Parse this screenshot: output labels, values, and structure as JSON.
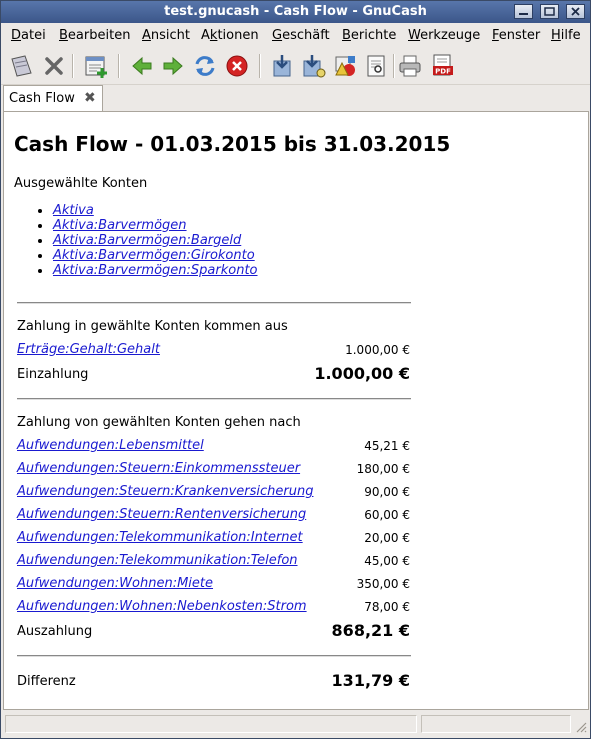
{
  "window": {
    "title": "test.gnucash - Cash Flow - GnuCash"
  },
  "menu": [
    {
      "label": "Datei"
    },
    {
      "label": "Bearbeiten"
    },
    {
      "label": "Ansicht"
    },
    {
      "label": "Aktionen"
    },
    {
      "label": "Geschäft"
    },
    {
      "label": "Berichte"
    },
    {
      "label": "Werkzeuge"
    },
    {
      "label": "Fenster"
    },
    {
      "label": "Hilfe"
    }
  ],
  "toolbar": {
    "icons": [
      "save-icon",
      "close-icon",
      "new-account-icon",
      "back-icon",
      "forward-icon",
      "reload-icon",
      "stop-icon",
      "export-icon",
      "options-icon",
      "chart-options-icon",
      "print-preview-icon",
      "print-icon",
      "pdf-icon"
    ]
  },
  "tab": {
    "label": "Cash Flow"
  },
  "report": {
    "title": "Cash Flow - 01.03.2015 bis 31.03.2015",
    "selected_label": "Ausgewählte Konten",
    "accounts": [
      "Aktiva",
      "Aktiva:Barvermögen",
      "Aktiva:Barvermögen:Bargeld",
      "Aktiva:Barvermögen:Girokonto",
      "Aktiva:Barvermögen:Sparkonto"
    ],
    "in_heading": "Zahlung in gewählte Konten kommen aus",
    "in_rows": [
      {
        "account": "Erträge:Gehalt:Gehalt",
        "amount": "1.000,00 €"
      }
    ],
    "in_total_label": "Einzahlung",
    "in_total": "1.000,00 €",
    "out_heading": "Zahlung von gewählten Konten gehen nach",
    "out_rows": [
      {
        "account": "Aufwendungen:Lebensmittel",
        "amount": "45,21 €"
      },
      {
        "account": "Aufwendungen:Steuern:Einkommenssteuer",
        "amount": "180,00 €"
      },
      {
        "account": "Aufwendungen:Steuern:Krankenversicherung",
        "amount": "90,00 €"
      },
      {
        "account": "Aufwendungen:Steuern:Rentenversicherung",
        "amount": "60,00 €"
      },
      {
        "account": "Aufwendungen:Telekommunikation:Internet",
        "amount": "20,00 €"
      },
      {
        "account": "Aufwendungen:Telekommunikation:Telefon",
        "amount": "45,00 €"
      },
      {
        "account": "Aufwendungen:Wohnen:Miete",
        "amount": "350,00 €"
      },
      {
        "account": "Aufwendungen:Wohnen:Nebenkosten:Strom",
        "amount": "78,00 €"
      }
    ],
    "out_total_label": "Auszahlung",
    "out_total": "868,21 €",
    "diff_label": "Differenz",
    "diff_total": "131,79 €"
  },
  "colors": {
    "titlebar": "#4a66a0",
    "link": "#1a1ad0"
  }
}
